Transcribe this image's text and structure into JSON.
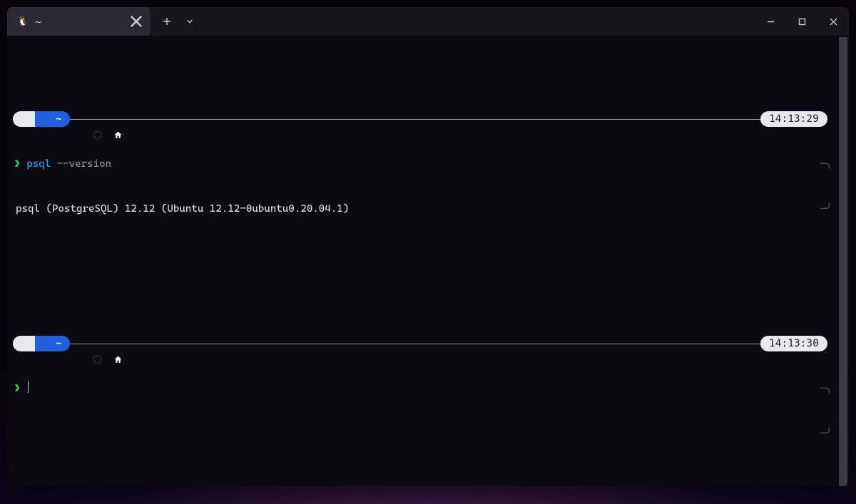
{
  "window": {
    "tab_title": "~",
    "tab_icon": "tux-icon"
  },
  "blocks": [
    {
      "os_icon": "ubuntu",
      "cwd_icon": "home",
      "cwd": "~",
      "time": "14:13:29",
      "prompt": "❯",
      "command_bin": "psql",
      "command_args": "--version",
      "output": "psql (PostgreSQL) 12.12 (Ubuntu 12.12-0ubuntu0.20.04.1)"
    },
    {
      "os_icon": "ubuntu",
      "cwd_icon": "home",
      "cwd": "~",
      "time": "14:13:30",
      "prompt": "❯",
      "command_bin": "",
      "command_args": "",
      "output": ""
    }
  ],
  "colors": {
    "accent_blue": "#1f5fe0",
    "pill_bg": "#e9e9ec",
    "term_bg": "#0b0a12",
    "cmd_blue": "#2f9fe6",
    "prompt_green": "#28c840"
  }
}
